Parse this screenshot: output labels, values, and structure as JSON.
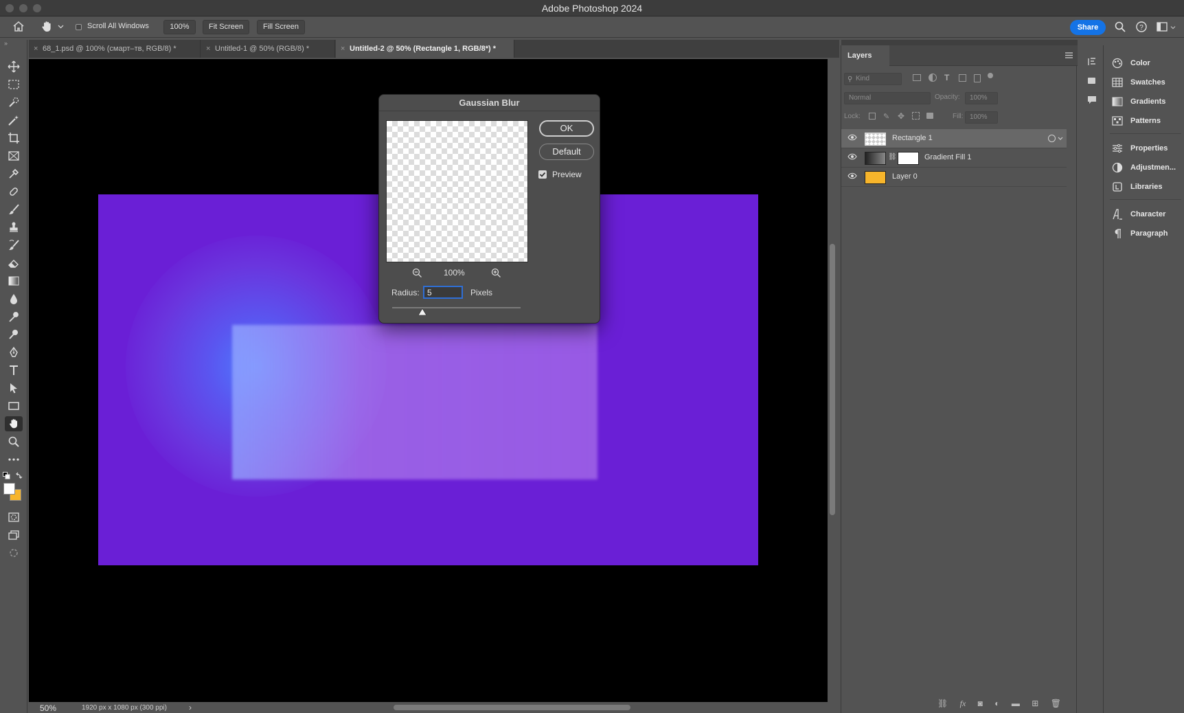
{
  "app": {
    "title": "Adobe Photoshop 2024"
  },
  "options_bar": {
    "scroll_all_windows": "Scroll All Windows",
    "zoom_value": "100%",
    "fit_screen": "Fit Screen",
    "fill_screen": "Fill Screen",
    "share": "Share"
  },
  "tabs": [
    {
      "label": "68_1.psd @ 100% (смарт–тв, RGB/8) *",
      "active": false
    },
    {
      "label": "Untitled-1 @ 50% (RGB/8) *",
      "active": false
    },
    {
      "label": "Untitled-2 @ 50% (Rectangle 1, RGB/8*) *",
      "active": true
    }
  ],
  "status": {
    "zoom": "50%",
    "doc_info": "1920 px x 1080 px (300 ppi)"
  },
  "dialog": {
    "title": "Gaussian Blur",
    "ok": "OK",
    "default": "Default",
    "preview_label": "Preview",
    "preview_checked": true,
    "zoom": "100%",
    "radius_label": "Radius:",
    "radius_value": "5",
    "units": "Pixels"
  },
  "layers_panel": {
    "tab": "Layers",
    "filter_kind": "Kind",
    "blend_mode": "Normal",
    "opacity_label": "Opacity:",
    "opacity_value": "100%",
    "lock_label": "Lock:",
    "fill_label": "Fill:",
    "fill_value": "100%",
    "layers": [
      {
        "name": "Rectangle 1",
        "selected": true
      },
      {
        "name": "Gradient Fill 1",
        "selected": false
      },
      {
        "name": "Layer 0",
        "selected": false
      }
    ]
  },
  "right_panel": {
    "items": [
      "Color",
      "Swatches",
      "Gradients",
      "Patterns",
      "Properties",
      "Adjustmen...",
      "Libraries",
      "Character",
      "Paragraph"
    ]
  },
  "colors": {
    "artboard_purple": "#6a1fd6",
    "accent_blue": "#1473e6",
    "layer0_thumb": "#f7b52b"
  }
}
